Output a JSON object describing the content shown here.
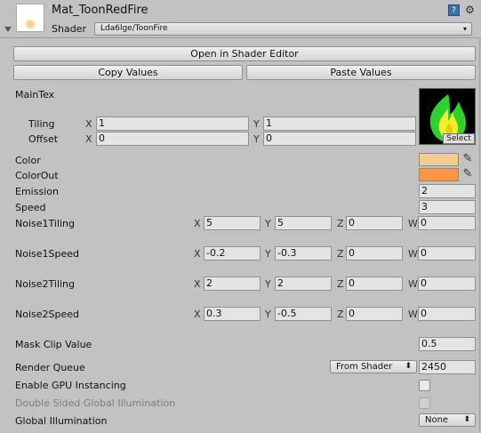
{
  "header": {
    "material_name": "Mat_ToonRedFire",
    "shader_label": "Shader",
    "shader_value": "Lda6lge/ToonFire",
    "dropdown_arrow": "▾",
    "book_icon": "help-book-icon",
    "gear_icon": "settings-gear-icon"
  },
  "buttons": {
    "open_shader_editor": "Open in Shader Editor",
    "copy_values": "Copy Values",
    "paste_values": "Paste Values"
  },
  "main_tex": {
    "label": "MainTex",
    "tiling_label": "Tiling",
    "offset_label": "Offset",
    "tiling_x": "1",
    "tiling_y": "1",
    "offset_x": "0",
    "offset_y": "0",
    "select_label": "Select"
  },
  "axes": {
    "x": "X",
    "y": "Y",
    "z": "Z",
    "w": "W"
  },
  "colors": {
    "color_label": "Color",
    "color_hex": "#f2cd8f",
    "color_out_label": "ColorOut",
    "color_out_hex": "#f6974a",
    "picker_icon": "eyedropper-icon"
  },
  "scalars": {
    "emission_label": "Emission",
    "emission_value": "2",
    "speed_label": "Speed",
    "speed_value": "3"
  },
  "vectors": [
    {
      "label": "Noise1Tiling",
      "x": "5",
      "y": "5",
      "z": "0",
      "w": "0"
    },
    {
      "label": "Noise1Speed",
      "x": "-0.2",
      "y": "-0.3",
      "z": "0",
      "w": "0"
    },
    {
      "label": "Noise2Tiling",
      "x": "2",
      "y": "2",
      "z": "0",
      "w": "0"
    },
    {
      "label": "Noise2Speed",
      "x": "0.3",
      "y": "-0.5",
      "z": "0",
      "w": "0"
    }
  ],
  "mask_clip": {
    "label": "Mask Clip Value",
    "value": "0.5"
  },
  "render_queue": {
    "label": "Render Queue",
    "mode": "From Shader",
    "value": "2450"
  },
  "gpu_instancing": {
    "label": "Enable GPU Instancing",
    "checked": false
  },
  "double_sided_gi": {
    "label": "Double Sided Global Illumination",
    "checked": false,
    "enabled": false
  },
  "global_illumination": {
    "label": "Global Illumination",
    "value": "None"
  },
  "popup_arrow": "⬍"
}
